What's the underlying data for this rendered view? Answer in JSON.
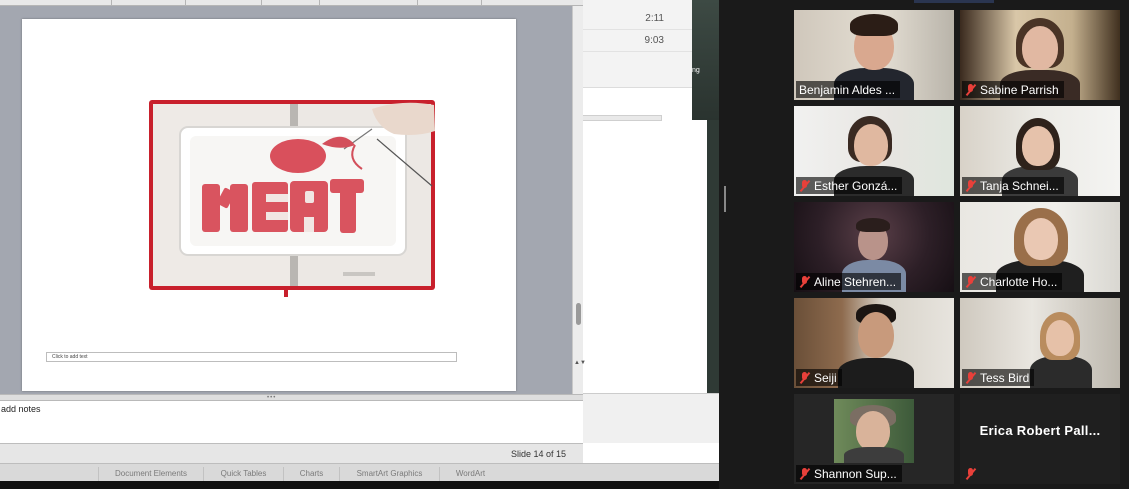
{
  "background_app": {
    "times": [
      "2:11",
      "9:03"
    ],
    "side_text": "ng"
  },
  "ppt": {
    "slide_textbox_placeholder": "Click to add text",
    "notes_placeholder": "add notes",
    "slide_counter": "Slide 14 of 15",
    "scroll_arrows": "▲▼"
  },
  "ribbon": {
    "tabs": [
      "Document Elements",
      "Quick Tables",
      "Charts",
      "SmartArt Graphics",
      "WordArt"
    ]
  },
  "zoom": {
    "participants": [
      {
        "name": "Benjamin Aldes ...",
        "muted": false,
        "speaking": true
      },
      {
        "name": "Sabine Parrish",
        "muted": true
      },
      {
        "name": "Esther Gonzá...",
        "muted": true
      },
      {
        "name": "Tanja Schnei...",
        "muted": true
      },
      {
        "name": "Aline Stehren...",
        "muted": true
      },
      {
        "name": "Charlotte Ho...",
        "muted": true
      },
      {
        "name": "Seiji",
        "muted": true
      },
      {
        "name": "Tess Bird",
        "muted": true
      },
      {
        "name": "Shannon Sup...",
        "muted": true
      },
      {
        "name": "Erica Robert Pall...",
        "muted": true,
        "video_off": true
      }
    ]
  },
  "colors": {
    "speaking_border": "#c8e06a",
    "mute_red": "#e8403a",
    "book_red": "#c8202c",
    "yarn_pink": "#d9505c"
  },
  "icons": [
    "microphone-muted-icon"
  ]
}
